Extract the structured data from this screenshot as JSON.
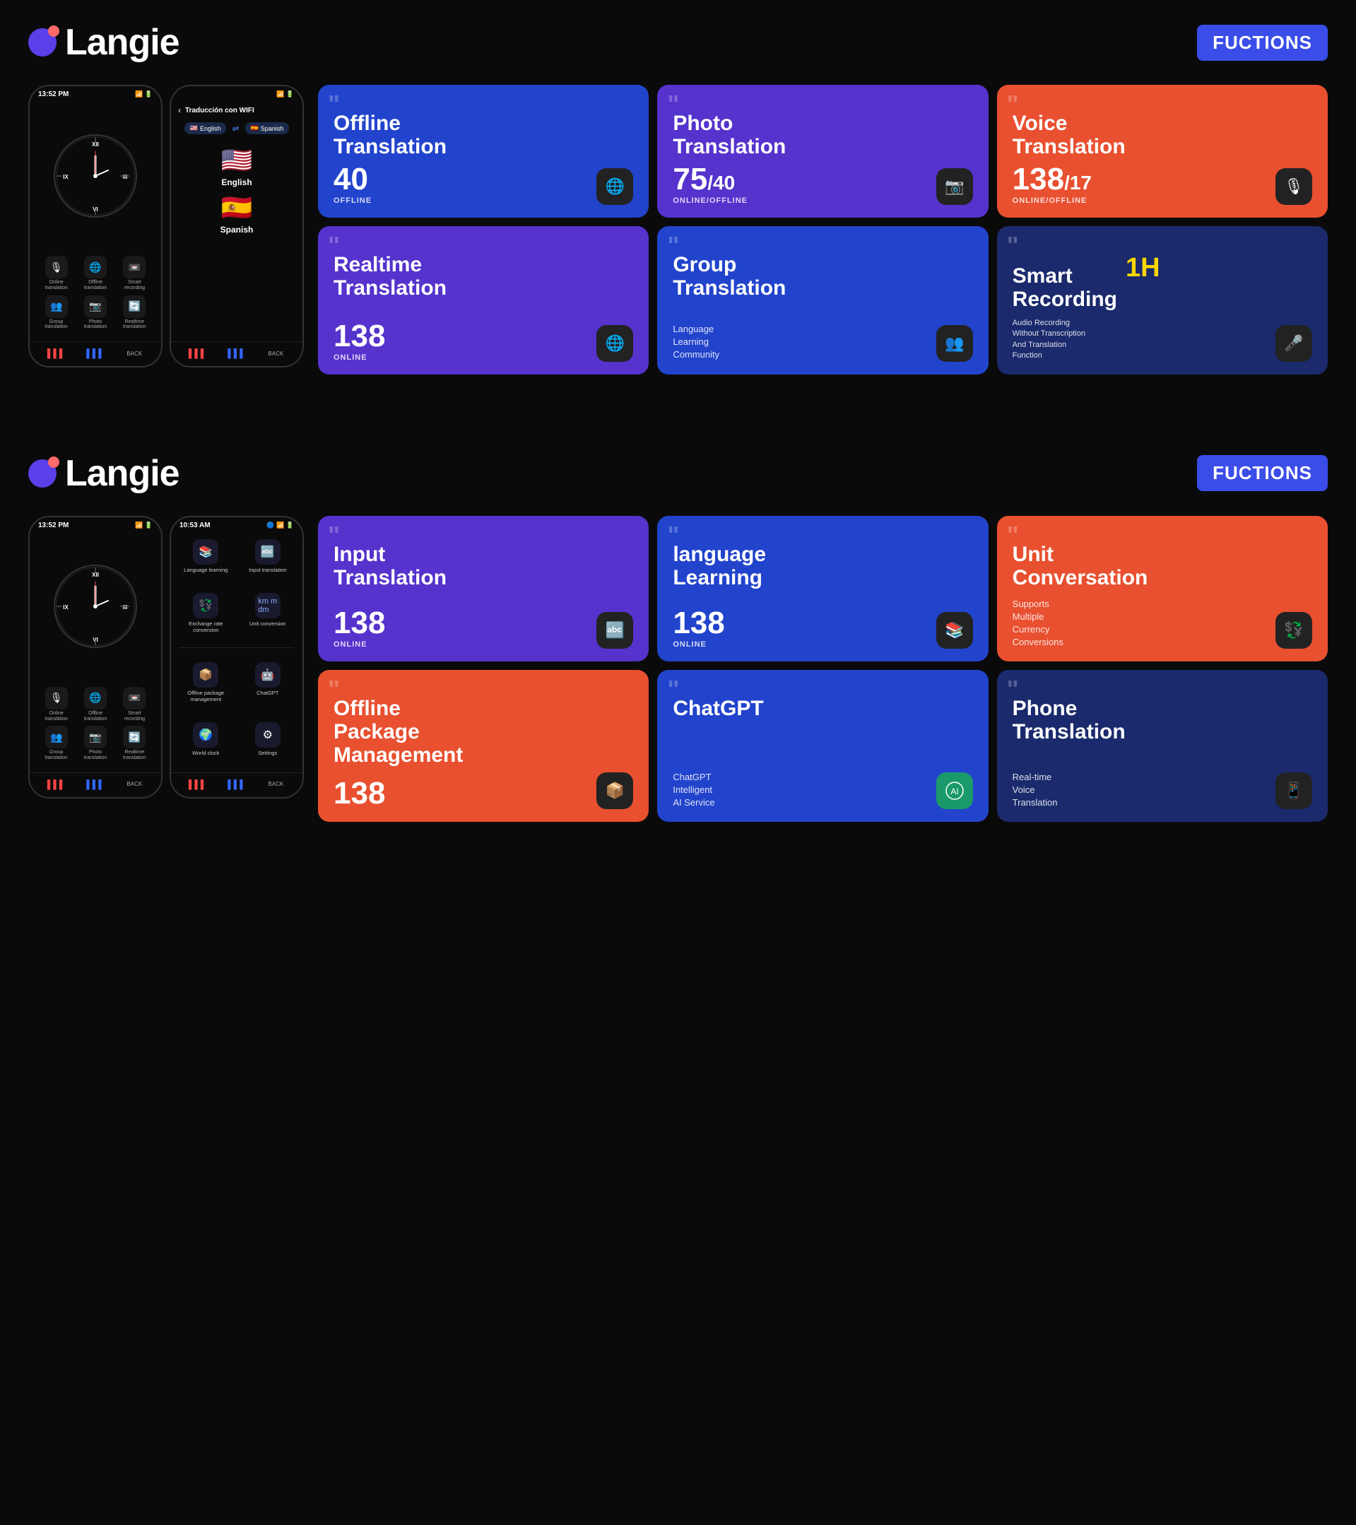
{
  "sections": [
    {
      "id": "section1",
      "logo": "Langie",
      "badge": "FUCTIONS",
      "phone1": {
        "time": "13:52 PM",
        "icons": [
          {
            "icon": "🎙",
            "label": "Online\ntranslation"
          },
          {
            "icon": "🌐",
            "label": "Offline\ntranslation"
          },
          {
            "icon": "📼",
            "label": "Smart\nrecording"
          }
        ],
        "icons2": [
          {
            "icon": "👥",
            "label": "Group\ntranslation"
          },
          {
            "icon": "📷",
            "label": "Photo\ntranslation"
          },
          {
            "icon": "🔄",
            "label": "Realtime\ntranslation"
          }
        ]
      },
      "phone2": {
        "time": "",
        "header": "Traducción con WIFI",
        "lang1": "English",
        "lang2": "Spanish",
        "flag1": "🇺🇸",
        "flag2": "🇪🇸"
      },
      "cards": [
        {
          "id": "offline-translation",
          "color": "card-blue",
          "title": "Offline\nTranslation",
          "count": "40",
          "countFraction": "",
          "badge": "OFFLINE",
          "icon": "🌐",
          "subtitleLines": []
        },
        {
          "id": "photo-translation",
          "color": "card-purple",
          "title": "Photo\nTranslation",
          "count": "75",
          "countFraction": "/40",
          "badge": "ONLINE/OFFLINE",
          "icon": "📷",
          "subtitleLines": []
        },
        {
          "id": "voice-translation",
          "color": "card-orange",
          "title": "Voice\nTranslation",
          "count": "138",
          "countFraction": "/17",
          "badge": "ONLINE/OFFLINE",
          "icon": "🎙",
          "subtitleLines": []
        },
        {
          "id": "realtime-translation",
          "color": "card-purple",
          "title": "Realtime\nTranslation",
          "count": "138",
          "countFraction": "",
          "badge": "ONLINE",
          "icon": "🌐",
          "subtitleLines": []
        },
        {
          "id": "group-translation",
          "color": "card-blue",
          "title": "Group\nTranslation",
          "count": "",
          "countFraction": "",
          "badge": "",
          "icon": "👥",
          "subtitleLines": [
            "Language",
            "Learning",
            "Community"
          ]
        },
        {
          "id": "smart-recording",
          "color": "card-dark-blue",
          "title": "Smart\nRecording",
          "count": "",
          "countFraction": "",
          "badge": "",
          "icon": "🎤",
          "highlight": "1H",
          "description": "Audio Recording Without Transcription And Translation Function",
          "subtitleLines": []
        }
      ]
    },
    {
      "id": "section2",
      "logo": "Langie",
      "badge": "FUCTIONS",
      "phone1": {
        "time": "13:52 PM",
        "icons": [
          {
            "icon": "🎙",
            "label": "Online\ntranslation"
          },
          {
            "icon": "🌐",
            "label": "Offline\ntranslation"
          },
          {
            "icon": "📼",
            "label": "Smart\nrecording"
          }
        ],
        "icons2": [
          {
            "icon": "👥",
            "label": "Group\ntranslation"
          },
          {
            "icon": "📷",
            "label": "Photo\ntranslation"
          },
          {
            "icon": "🔄",
            "label": "Realtime\ntranslation"
          }
        ]
      },
      "phone2": {
        "time": "10:53 AM",
        "menuItems": [
          {
            "icon": "📚",
            "label": "Language learning"
          },
          {
            "icon": "🔤",
            "label": "Input translation"
          },
          {
            "icon": "💱",
            "label": "Exchange rate\nconversion"
          },
          {
            "icon": "📏",
            "label": "Unit conversion"
          },
          {
            "icon": "📦",
            "label": "Offline package\nmanagement"
          },
          {
            "icon": "🤖",
            "label": "ChatGPT"
          },
          {
            "icon": "🌍",
            "label": "World clock"
          },
          {
            "icon": "⚙",
            "label": "Settings"
          }
        ]
      },
      "cards": [
        {
          "id": "input-translation",
          "color": "card-purple",
          "title": "Input\nTranslation",
          "count": "138",
          "countFraction": "",
          "badge": "ONLINE",
          "icon": "🔤",
          "subtitleLines": []
        },
        {
          "id": "language-learning",
          "color": "card-blue",
          "title": "language\nLearning",
          "count": "138",
          "countFraction": "",
          "badge": "ONLINE",
          "icon": "📚",
          "subtitleLines": []
        },
        {
          "id": "unit-conversation",
          "color": "card-orange",
          "title": "Unit\nConversation",
          "count": "",
          "countFraction": "",
          "badge": "",
          "icon": "💱",
          "subtitleLines": [
            "Supports",
            "Multiple",
            "Currency",
            "Conversions"
          ]
        },
        {
          "id": "offline-package",
          "color": "card-orange",
          "title": "Offline\nPackage\nManagement",
          "count": "138",
          "countFraction": "",
          "badge": "",
          "icon": "📦",
          "subtitleLines": []
        },
        {
          "id": "chatgpt",
          "color": "card-blue",
          "title": "ChatGPT",
          "count": "",
          "countFraction": "",
          "badge": "",
          "icon": "🤖",
          "subtitleLines": [
            "ChatGPT",
            "Intelligent",
            "AI Service"
          ]
        },
        {
          "id": "phone-translation",
          "color": "card-dark-blue",
          "title": "Phone\nTranslation",
          "count": "",
          "countFraction": "",
          "badge": "",
          "icon": "📱",
          "subtitleLines": [
            "Real-time",
            "Voice",
            "Translation"
          ]
        }
      ]
    }
  ]
}
